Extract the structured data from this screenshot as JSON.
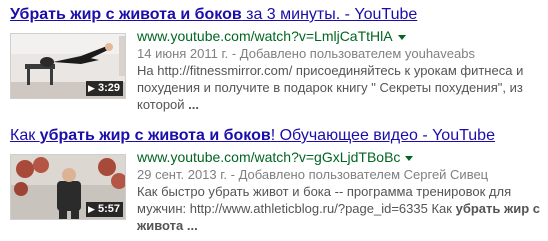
{
  "results": [
    {
      "title_bold": "Убрать жир с живота и боков",
      "title_rest": " за 3 минуты. - YouTube",
      "url": "www.youtube.com/watch?v=LmljCaTtHlA",
      "meta": "14 июня 2011 г. - Добавлено пользователем youhaveabs",
      "snippet": "На http://fitnessmirror.com/ присоединяйтесь к урокам фитнеса и похудения и получите в подарок книгу \" Секреты похудения\", из которой",
      "snippet_end": "...",
      "duration": "3:29",
      "menu_icon": "dropdown-triangle-icon",
      "play_icon": "play-icon"
    },
    {
      "title_prefix": "Как ",
      "title_bold": "убрать жир с живота и боков",
      "title_rest": "! Обучающее видео - YouTube",
      "url": "www.youtube.com/watch?v=gGxLjdTBoBc",
      "meta": "29 сент. 2013 г. - Добавлено пользователем Сергей Сивец",
      "snippet": "Как быстро убрать живот и бока -- программа тренировок для мужчин: http://www.athleticblog.ru/?page_id=6335 Как",
      "snippet_bold": "убрать жир с живота",
      "snippet_end": "...",
      "duration": "5:57",
      "menu_icon": "dropdown-triangle-icon",
      "play_icon": "play-icon"
    }
  ],
  "colors": {
    "title": "#1a0dab",
    "url": "#006621",
    "meta": "#808080",
    "snippet": "#545454"
  }
}
